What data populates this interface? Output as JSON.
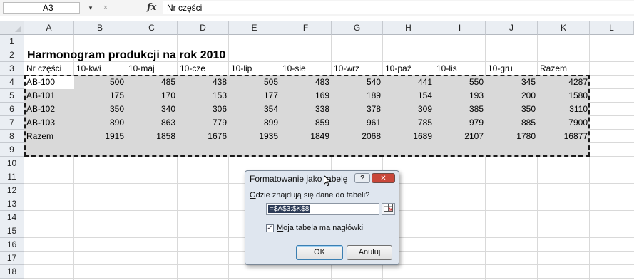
{
  "formula_bar": {
    "name_box": "A3",
    "formula": "Nr części",
    "fx_label": "fx",
    "cancel_label": "×",
    "dropdown_label": "▾"
  },
  "columns": [
    "A",
    "B",
    "C",
    "D",
    "E",
    "F",
    "G",
    "H",
    "I",
    "J",
    "K",
    "L"
  ],
  "rows": [
    "1",
    "2",
    "3",
    "4",
    "5",
    "6",
    "7",
    "8",
    "9",
    "10",
    "11",
    "12",
    "13",
    "14",
    "15",
    "16",
    "17",
    "18"
  ],
  "sheet": {
    "title": "Harmonogram produkcji na rok 2010",
    "headers": [
      "Nr części",
      "10-kwi",
      "10-maj",
      "10-cze",
      "10-lip",
      "10-sie",
      "10-wrz",
      "10-paź",
      "10-lis",
      "10-gru",
      "Razem"
    ],
    "data_rows": [
      [
        "AB-100",
        "500",
        "485",
        "438",
        "505",
        "483",
        "540",
        "441",
        "550",
        "345",
        "4287"
      ],
      [
        "AB-101",
        "175",
        "170",
        "153",
        "177",
        "169",
        "189",
        "154",
        "193",
        "200",
        "1580"
      ],
      [
        "AB-102",
        "350",
        "340",
        "306",
        "354",
        "338",
        "378",
        "309",
        "385",
        "350",
        "3110"
      ],
      [
        "AB-103",
        "890",
        "863",
        "779",
        "899",
        "859",
        "961",
        "785",
        "979",
        "885",
        "7900"
      ],
      [
        "Razem",
        "1915",
        "1858",
        "1676",
        "1935",
        "1849",
        "2068",
        "1689",
        "2107",
        "1780",
        "16877"
      ]
    ]
  },
  "dialog": {
    "title": "Formatowanie jako tabelę",
    "help_label": "?",
    "close_label": "✕",
    "range_label_key": "G",
    "range_label_rest": "dzie znajdują się dane do tabeli?",
    "range_value": "=$A$3:$K$8",
    "checkbox_checked": true,
    "checkbox_mark": "✓",
    "checkbox_label_key": "M",
    "checkbox_label_rest": "oja tabela ma nagłówki",
    "ok_label": "OK",
    "cancel_label": "Anuluj"
  }
}
